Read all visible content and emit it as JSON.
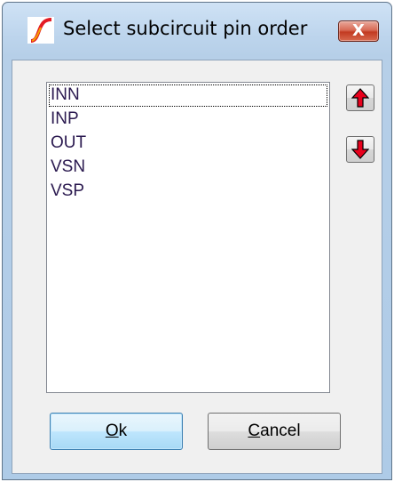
{
  "window": {
    "title": "Select subcircuit pin order",
    "app_icon": "ltspice-logo-icon",
    "close_icon": "close-icon",
    "close_glyph": "X"
  },
  "pins": {
    "items": [
      {
        "label": "INN",
        "focused": true
      },
      {
        "label": "INP",
        "focused": false
      },
      {
        "label": "OUT",
        "focused": false
      },
      {
        "label": "VSN",
        "focused": false
      },
      {
        "label": "VSP",
        "focused": false
      }
    ]
  },
  "controls": {
    "move_up_icon": "arrow-up-icon",
    "move_down_icon": "arrow-down-icon",
    "arrow_color": "#e8001c"
  },
  "buttons": {
    "ok_mnemonic": "O",
    "ok_rest": "k",
    "cancel_mnemonic": "C",
    "cancel_rest": "ancel"
  }
}
